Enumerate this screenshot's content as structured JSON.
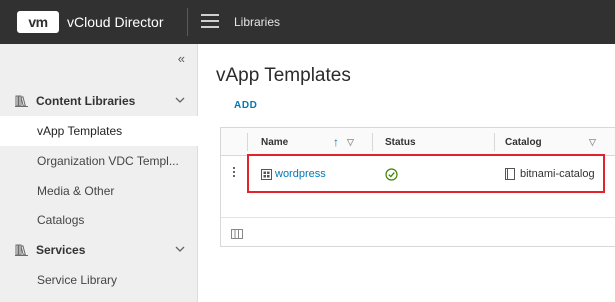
{
  "header": {
    "logo_text": "vm",
    "app_title": "vCloud Director",
    "nav_title": "Libraries"
  },
  "sidebar": {
    "collapse_glyph": "«",
    "items": [
      {
        "label": "Content Libraries",
        "type": "group",
        "icon": "library-icon"
      },
      {
        "label": "vApp Templates",
        "type": "sub",
        "active": true
      },
      {
        "label": "Organization VDC Templ...",
        "type": "sub"
      },
      {
        "label": "Media & Other",
        "type": "sub"
      },
      {
        "label": "Catalogs",
        "type": "sub"
      },
      {
        "label": "Services",
        "type": "group",
        "icon": "library-icon"
      },
      {
        "label": "Service Library",
        "type": "sub"
      }
    ]
  },
  "main": {
    "title": "vApp Templates",
    "add_label": "ADD",
    "columns": [
      {
        "label": "Name",
        "sorted": "ascending"
      },
      {
        "label": "Status"
      },
      {
        "label": "Catalog"
      }
    ],
    "rows": [
      {
        "name": "wordpress",
        "status": "ok",
        "catalog": "bitnami-catalog"
      }
    ]
  },
  "colors": {
    "header_bg": "#313131",
    "accent": "#0079b8",
    "highlight": "#e3232c",
    "status_ok": "#3c8500"
  }
}
